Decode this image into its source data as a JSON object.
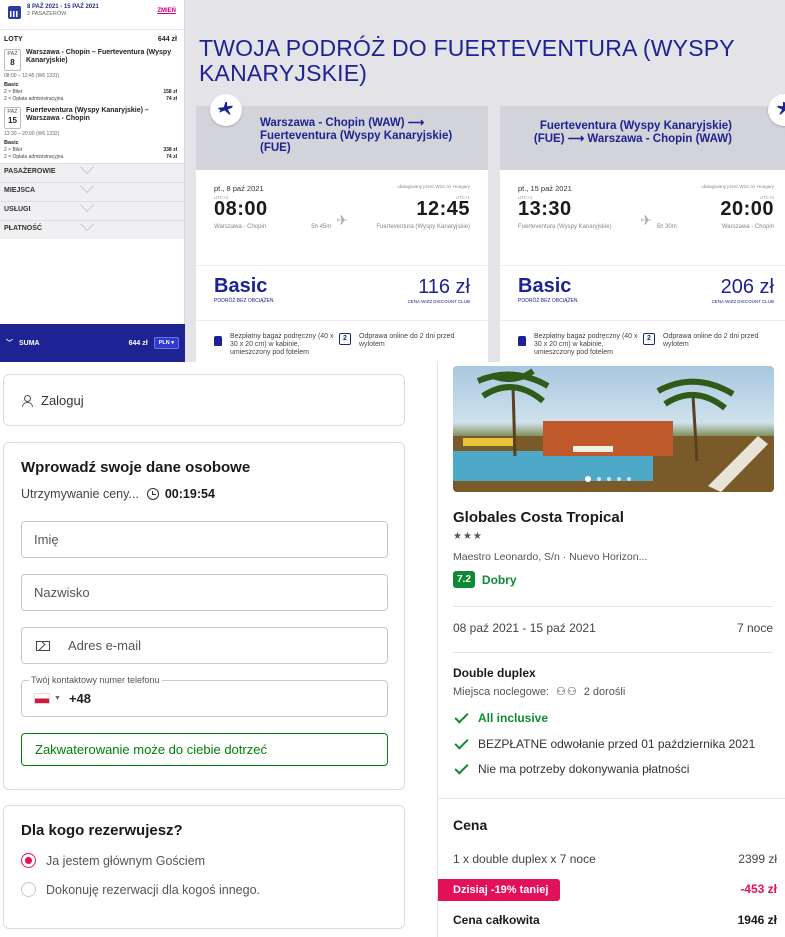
{
  "flight": {
    "header": {
      "dates": "8 PAŹ 2021 - 15 PAŹ 2021",
      "passengers": "2 PASAŻERÓW",
      "change": "ZMIEŃ"
    },
    "sidebar": {
      "flights_label": "LOTY",
      "flights_total": "644 zł",
      "legs": [
        {
          "month": "PAŹ",
          "day": "8",
          "route": "Warszawa - Chopin – Fuerteventura (Wyspy Kanaryjskie)",
          "time": "08:00 – 12:45 (W6 1331)",
          "fare": "Basic",
          "ticket": "2 × Bilet",
          "ticket_price": "158 zł",
          "fee": "2 × Opłata administracyjna",
          "fee_price": "74 zł"
        },
        {
          "month": "PAŹ",
          "day": "15",
          "route": "Fuerteventura (Wyspy Kanaryjskie) – Warszawa - Chopin",
          "time": "13:30 – 20:00 (W6 1332)",
          "fare": "Basic",
          "ticket": "2 × Bilet",
          "ticket_price": "338 zł",
          "fee": "2 × Opłata administracyjna",
          "fee_price": "74 zł"
        }
      ],
      "sections": [
        "PASAŻEROWIE",
        "MIEJSCA",
        "USŁUGI",
        "PŁATNOŚĆ"
      ],
      "sum_label": "SUMA",
      "sum_value": "644 zł",
      "currency": "PLN"
    },
    "title": "TWOJA PODRÓŻ DO FUERTEVENTURA (WYSPY KANARYJSKIE)",
    "cards": [
      {
        "route": "Warszawa - Chopin (WAW) ⟶ Fuerteventura (Wyspy Kanaryjskie) (FUE)",
        "date": "pt., 8 paź 2021",
        "operator": "obsługiwany przez Wizz Air Hungary",
        "utc_dep": "UTC+2",
        "utc_arr": "UTC+1",
        "dep": "08:00",
        "arr": "12:45",
        "duration": "5h 45m",
        "from": "Warszawa - Chopin",
        "to": "Fuerteventura (Wyspy Kanaryjskie)",
        "fare": "Basic",
        "fare_sub": "PODRÓŻ BEZ OBCIĄŻEŃ",
        "price": "116 zł",
        "club": "CENA WIZZ DISCOUNT CLUB",
        "feat1": "Bezpłatny bagaż podręczny (40 x 30 x 20 cm) w kabinie, umieszczony pod fotelem",
        "feat2": "Odprawa online do 2 dni przed wylotem"
      },
      {
        "route": "Fuerteventura (Wyspy Kanaryjskie) (FUE) ⟶ Warszawa - Chopin (WAW)",
        "date": "pt., 15 paź 2021",
        "operator": "obsługiwany przez Wizz Air Hungary",
        "utc_dep": "UTC+1",
        "utc_arr": "UTC+2",
        "dep": "13:30",
        "arr": "20:00",
        "duration": "5h 30m",
        "from": "Fuerteventura (Wyspy Kanaryjskie)",
        "to": "Warszawa - Chopin",
        "fare": "Basic",
        "fare_sub": "PODRÓŻ BEZ OBCIĄŻEŃ",
        "price": "206 zł",
        "club": "CENA WIZZ DISCOUNT CLUB",
        "feat1": "Bezpłatny bagaż podręczny (40 x 30 x 20 cm) w kabinie, umieszczony pod fotelem",
        "feat2": "Odprawa online do 2 dni przed wylotem"
      }
    ],
    "accent": "#1d2393",
    "link_color": "#c6007e"
  },
  "form": {
    "login": "Zaloguj",
    "title": "Wprowadź swoje dane osobowe",
    "hold_text": "Utrzymywanie ceny...",
    "timer": "00:19:54",
    "first_name_placeholder": "Imię",
    "last_name_placeholder": "Nazwisko",
    "email_placeholder": "Adres e-mail",
    "phone_label": "Twój kontaktowy numer telefonu",
    "phone_prefix": "+48",
    "notice": "Zakwaterowanie może do ciebie dotrzeć",
    "who_title": "Dla kogo rezerwujesz?",
    "options": [
      "Ja jestem głównym Gościem",
      "Dokonuję rezerwacji dla kogoś innego."
    ],
    "selected_option": 0
  },
  "hotel": {
    "name": "Globales Costa Tropical",
    "stars": "★★★",
    "address": "Maestro Leonardo, S/n · Nuevo Horizon...",
    "score": "7.2",
    "score_label": "Dobry",
    "dates": "08 paź 2021 - 15 paź 2021",
    "nights": "7 noce",
    "room": "Double duplex",
    "beds_label": "Miejsca noclegowe:",
    "guests": "2 dorośli",
    "features": [
      "All inclusive",
      "BEZPŁATNE odwołanie przed 01 października 2021",
      "Nie ma potrzeby dokonywania płatności"
    ],
    "price_title": "Cena",
    "line_label": "1 x double duplex x 7 noce",
    "line_value": "2399 zł",
    "discount_label": "Dzisiaj -19% taniej",
    "discount_value": "-453 zł",
    "total_label": "Cena całkowita",
    "total_value": "1946 zł",
    "brand_green": "#0f8a34",
    "brand_pink": "#e3105a"
  }
}
